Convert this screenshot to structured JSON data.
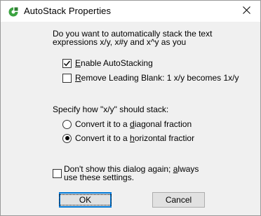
{
  "window": {
    "title": "AutoStack Properties",
    "close_symbol": "✕"
  },
  "icons": {
    "app": "autostack-app-icon",
    "close": "close-icon",
    "checkmark": "checkmark-icon",
    "radio_dot": "radio-selected-dot"
  },
  "question": {
    "line1": "Do you want to automatically stack the text",
    "line2": "expressions x/y, x#y and x^y as you"
  },
  "enable_autostacking": {
    "label_pre": "",
    "label_accel": "E",
    "label_post": "nable AutoStacking",
    "checked": true
  },
  "remove_leading_blank": {
    "label_pre": "",
    "label_accel": "R",
    "label_post": "emove Leading Blank: 1 x/y becomes 1x/y",
    "checked": false
  },
  "stack_prompt": "Specify how \"x/y\" should stack:",
  "diagonal": {
    "label_pre": "Convert it to a ",
    "label_accel": "d",
    "label_post": "iagonal fraction",
    "selected": false
  },
  "horizontal": {
    "label_pre": "Convert it to a ",
    "label_accel": "h",
    "label_post": "orizontal fractior",
    "selected": true
  },
  "dont_show": {
    "line1_pre": "Don't show this dialog again; ",
    "line1_accel": "a",
    "line1_post": "lways",
    "line2": "use these settings.",
    "checked": false
  },
  "buttons": {
    "ok": "OK",
    "cancel": "Cancel"
  },
  "colors": {
    "icon_green": "#3aa340",
    "default_button_border": "#0078d7",
    "dialog_bg": "#f0f0f0"
  }
}
